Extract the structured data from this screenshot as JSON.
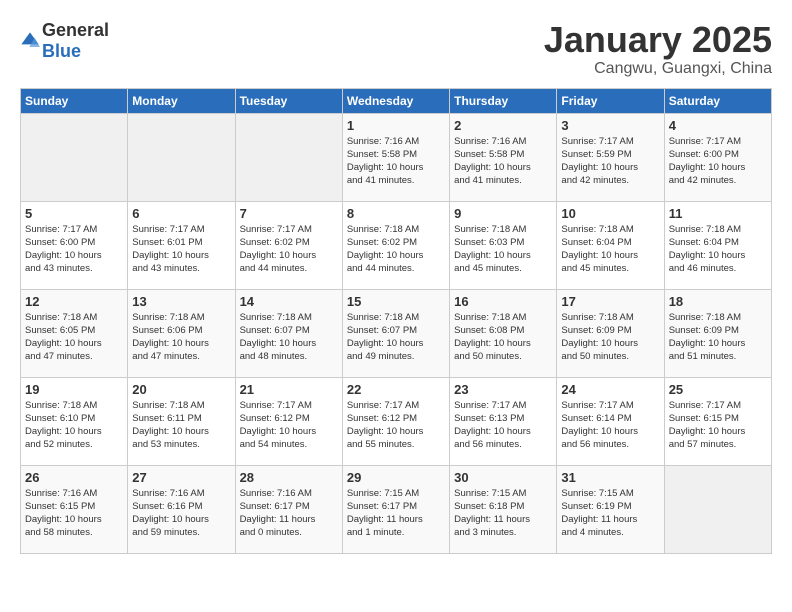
{
  "header": {
    "logo_general": "General",
    "logo_blue": "Blue",
    "month": "January 2025",
    "location": "Cangwu, Guangxi, China"
  },
  "weekdays": [
    "Sunday",
    "Monday",
    "Tuesday",
    "Wednesday",
    "Thursday",
    "Friday",
    "Saturday"
  ],
  "weeks": [
    [
      {
        "day": "",
        "info": ""
      },
      {
        "day": "",
        "info": ""
      },
      {
        "day": "",
        "info": ""
      },
      {
        "day": "1",
        "info": "Sunrise: 7:16 AM\nSunset: 5:58 PM\nDaylight: 10 hours\nand 41 minutes."
      },
      {
        "day": "2",
        "info": "Sunrise: 7:16 AM\nSunset: 5:58 PM\nDaylight: 10 hours\nand 41 minutes."
      },
      {
        "day": "3",
        "info": "Sunrise: 7:17 AM\nSunset: 5:59 PM\nDaylight: 10 hours\nand 42 minutes."
      },
      {
        "day": "4",
        "info": "Sunrise: 7:17 AM\nSunset: 6:00 PM\nDaylight: 10 hours\nand 42 minutes."
      }
    ],
    [
      {
        "day": "5",
        "info": "Sunrise: 7:17 AM\nSunset: 6:00 PM\nDaylight: 10 hours\nand 43 minutes."
      },
      {
        "day": "6",
        "info": "Sunrise: 7:17 AM\nSunset: 6:01 PM\nDaylight: 10 hours\nand 43 minutes."
      },
      {
        "day": "7",
        "info": "Sunrise: 7:17 AM\nSunset: 6:02 PM\nDaylight: 10 hours\nand 44 minutes."
      },
      {
        "day": "8",
        "info": "Sunrise: 7:18 AM\nSunset: 6:02 PM\nDaylight: 10 hours\nand 44 minutes."
      },
      {
        "day": "9",
        "info": "Sunrise: 7:18 AM\nSunset: 6:03 PM\nDaylight: 10 hours\nand 45 minutes."
      },
      {
        "day": "10",
        "info": "Sunrise: 7:18 AM\nSunset: 6:04 PM\nDaylight: 10 hours\nand 45 minutes."
      },
      {
        "day": "11",
        "info": "Sunrise: 7:18 AM\nSunset: 6:04 PM\nDaylight: 10 hours\nand 46 minutes."
      }
    ],
    [
      {
        "day": "12",
        "info": "Sunrise: 7:18 AM\nSunset: 6:05 PM\nDaylight: 10 hours\nand 47 minutes."
      },
      {
        "day": "13",
        "info": "Sunrise: 7:18 AM\nSunset: 6:06 PM\nDaylight: 10 hours\nand 47 minutes."
      },
      {
        "day": "14",
        "info": "Sunrise: 7:18 AM\nSunset: 6:07 PM\nDaylight: 10 hours\nand 48 minutes."
      },
      {
        "day": "15",
        "info": "Sunrise: 7:18 AM\nSunset: 6:07 PM\nDaylight: 10 hours\nand 49 minutes."
      },
      {
        "day": "16",
        "info": "Sunrise: 7:18 AM\nSunset: 6:08 PM\nDaylight: 10 hours\nand 50 minutes."
      },
      {
        "day": "17",
        "info": "Sunrise: 7:18 AM\nSunset: 6:09 PM\nDaylight: 10 hours\nand 50 minutes."
      },
      {
        "day": "18",
        "info": "Sunrise: 7:18 AM\nSunset: 6:09 PM\nDaylight: 10 hours\nand 51 minutes."
      }
    ],
    [
      {
        "day": "19",
        "info": "Sunrise: 7:18 AM\nSunset: 6:10 PM\nDaylight: 10 hours\nand 52 minutes."
      },
      {
        "day": "20",
        "info": "Sunrise: 7:18 AM\nSunset: 6:11 PM\nDaylight: 10 hours\nand 53 minutes."
      },
      {
        "day": "21",
        "info": "Sunrise: 7:17 AM\nSunset: 6:12 PM\nDaylight: 10 hours\nand 54 minutes."
      },
      {
        "day": "22",
        "info": "Sunrise: 7:17 AM\nSunset: 6:12 PM\nDaylight: 10 hours\nand 55 minutes."
      },
      {
        "day": "23",
        "info": "Sunrise: 7:17 AM\nSunset: 6:13 PM\nDaylight: 10 hours\nand 56 minutes."
      },
      {
        "day": "24",
        "info": "Sunrise: 7:17 AM\nSunset: 6:14 PM\nDaylight: 10 hours\nand 56 minutes."
      },
      {
        "day": "25",
        "info": "Sunrise: 7:17 AM\nSunset: 6:15 PM\nDaylight: 10 hours\nand 57 minutes."
      }
    ],
    [
      {
        "day": "26",
        "info": "Sunrise: 7:16 AM\nSunset: 6:15 PM\nDaylight: 10 hours\nand 58 minutes."
      },
      {
        "day": "27",
        "info": "Sunrise: 7:16 AM\nSunset: 6:16 PM\nDaylight: 10 hours\nand 59 minutes."
      },
      {
        "day": "28",
        "info": "Sunrise: 7:16 AM\nSunset: 6:17 PM\nDaylight: 11 hours\nand 0 minutes."
      },
      {
        "day": "29",
        "info": "Sunrise: 7:15 AM\nSunset: 6:17 PM\nDaylight: 11 hours\nand 1 minute."
      },
      {
        "day": "30",
        "info": "Sunrise: 7:15 AM\nSunset: 6:18 PM\nDaylight: 11 hours\nand 3 minutes."
      },
      {
        "day": "31",
        "info": "Sunrise: 7:15 AM\nSunset: 6:19 PM\nDaylight: 11 hours\nand 4 minutes."
      },
      {
        "day": "",
        "info": ""
      }
    ]
  ]
}
